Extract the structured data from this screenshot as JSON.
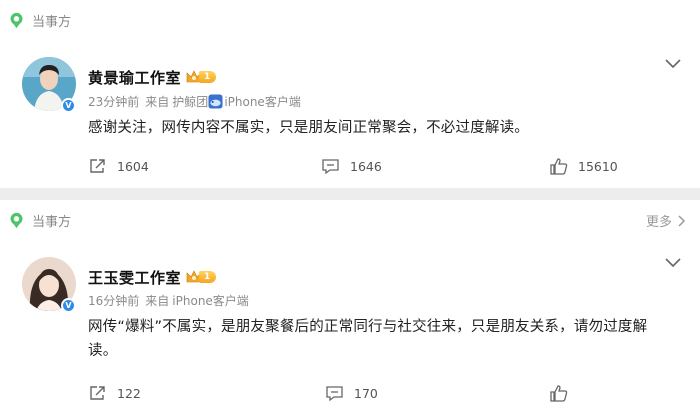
{
  "posts": [
    {
      "section_label": "当事方",
      "author": "黄景瑜工作室",
      "member_level": "1",
      "time_ago": "23分钟前",
      "source_prefix": "来自",
      "source_app": "护鲸团",
      "source_device": "iPhone客户端",
      "text": "感谢关注，网传内容不属实，只是朋友间正常聚会，不必过度解读。",
      "reposts": "1604",
      "comments": "1646",
      "likes": "15610"
    },
    {
      "section_label": "当事方",
      "more_label": "更多",
      "author": "王玉雯工作室",
      "member_level": "1",
      "time_ago": "16分钟前",
      "source_prefix": "来自",
      "source_device": "iPhone客户端",
      "text_line1": "网传“爆料”不属实，是朋友聚餐后的正常同行与社交往来，只是朋友关系，请勿过度解",
      "text_line2": "读。",
      "reposts": "122",
      "comments": "170"
    }
  ],
  "colors": {
    "verified_blue": "#2f8ce5",
    "section_icon_green": "#4cc46a",
    "member_gold": "#f5a623"
  },
  "icons": [
    "location-pin-icon",
    "verified-v-icon",
    "crown-icon",
    "chevron-down-icon",
    "chevron-right-icon",
    "repost-icon",
    "comment-icon",
    "like-icon",
    "whale-app-icon"
  ]
}
